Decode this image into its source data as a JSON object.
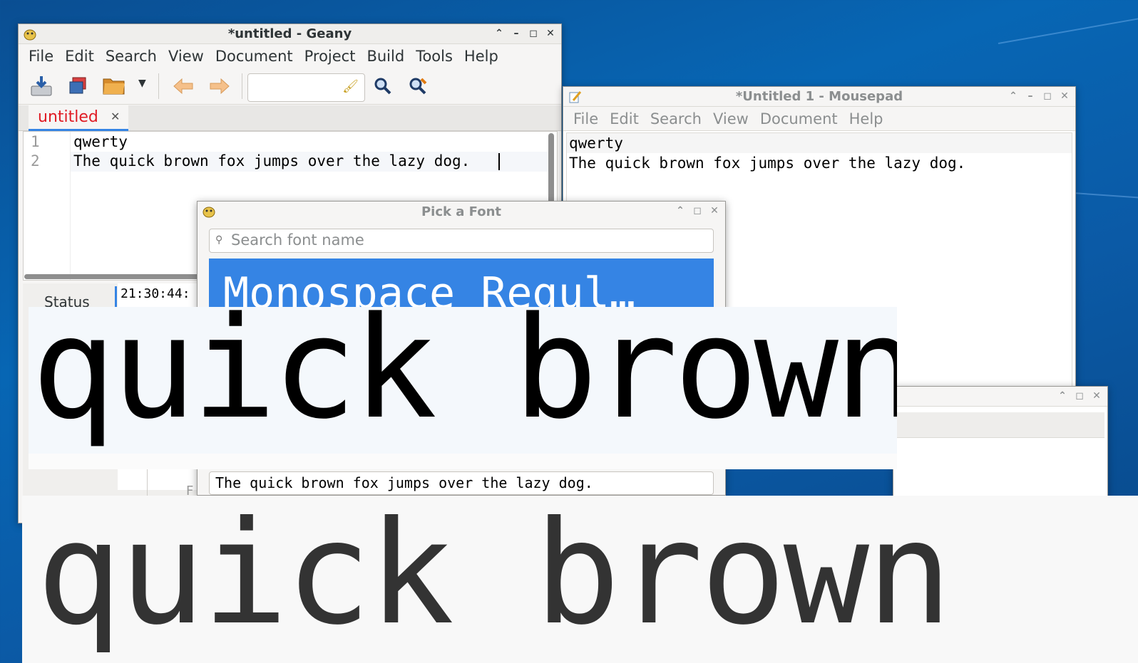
{
  "geany": {
    "title": "*untitled - Geany",
    "menu": [
      "File",
      "Edit",
      "Search",
      "View",
      "Document",
      "Project",
      "Build",
      "Tools",
      "Help"
    ],
    "tab_label": "untitled",
    "line_numbers": [
      "1",
      "2"
    ],
    "lines": [
      "qwerty",
      "The quick brown fox jumps over the lazy dog."
    ],
    "status_tab": "Status",
    "status_time": "21:30:44:",
    "partial_tab_letter": "F"
  },
  "mousepad": {
    "title": "*Untitled 1 - Mousepad",
    "menu": [
      "File",
      "Edit",
      "Search",
      "View",
      "Document",
      "Help"
    ],
    "lines": [
      "qwerty",
      "The quick brown fox jumps over the lazy dog."
    ]
  },
  "font_dialog": {
    "title": "Pick a Font",
    "search_placeholder": "Search font name",
    "selected_font": "Monospace Regul…",
    "preview_text": "The quick brown fox jumps over the lazy dog."
  },
  "zoom": {
    "magnified_top": "quick brown",
    "magnified_bottom": "quick brown"
  },
  "colors": {
    "selection_blue": "#3584e4",
    "tab_red": "#e01b24",
    "desktop_blue": "#0766b4"
  }
}
